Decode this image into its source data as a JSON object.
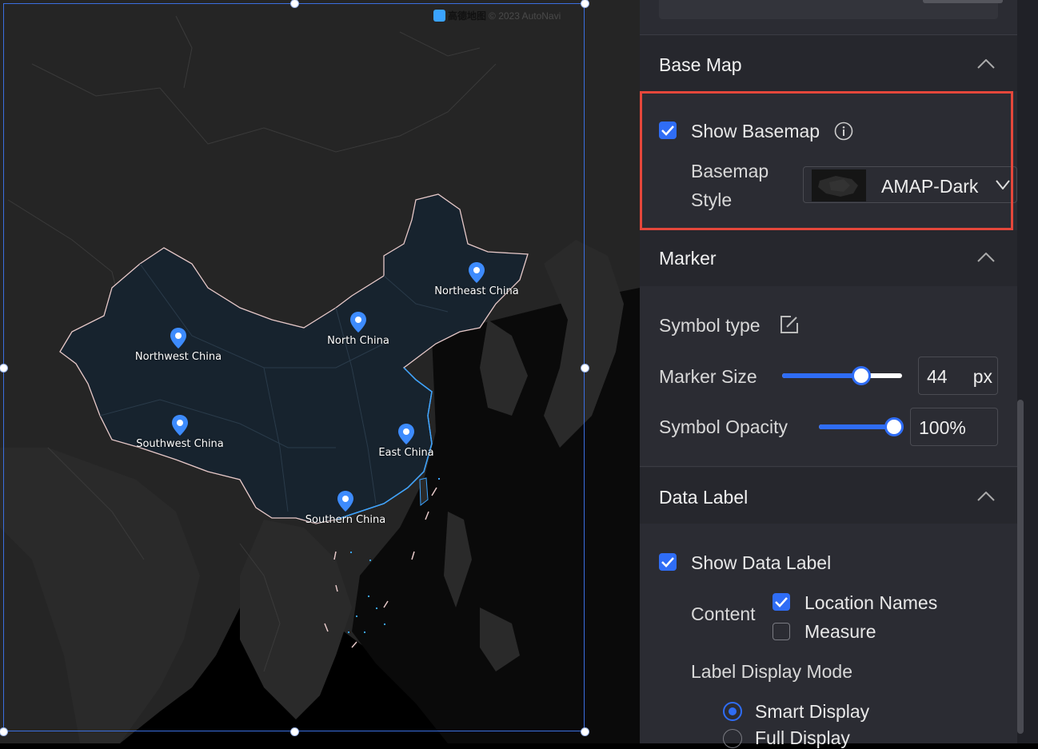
{
  "map": {
    "attribution_brand": "高德地图",
    "attribution_text": "© 2023 AutoNavi",
    "markers": [
      {
        "label": "Northeast China"
      },
      {
        "label": "North China"
      },
      {
        "label": "Northwest China"
      },
      {
        "label": "Southwest China"
      },
      {
        "label": "East China"
      },
      {
        "label": "Southern China"
      }
    ],
    "colors": {
      "region_fill": "#17232e",
      "region_border": "#e7c9c9",
      "marker": "#3d8bfd",
      "coast": "#3aa3ff"
    }
  },
  "panel": {
    "base_map": {
      "title": "Base Map",
      "show_basemap_label": "Show Basemap",
      "show_basemap_checked": true,
      "style_label_line1": "Basemap",
      "style_label_line2": "Style",
      "style_value": "AMAP-Dark"
    },
    "marker": {
      "title": "Marker",
      "symbol_type_label": "Symbol type",
      "marker_size_label": "Marker Size",
      "marker_size_value": "44",
      "marker_size_unit": "px",
      "marker_size_slider_fraction": 0.66,
      "symbol_opacity_label": "Symbol Opacity",
      "symbol_opacity_value": "100%",
      "symbol_opacity_slider_fraction": 1.0
    },
    "data_label": {
      "title": "Data Label",
      "show_data_label_label": "Show Data Label",
      "show_data_label_checked": true,
      "content_label": "Content",
      "location_names_label": "Location Names",
      "location_names_checked": true,
      "measure_label": "Measure",
      "measure_checked": false,
      "display_mode_label": "Label Display Mode",
      "smart_display_label": "Smart Display",
      "smart_display_selected": true,
      "full_display_label": "Full Display"
    },
    "accent_color": "#2f6df6",
    "highlight_color": "#e5473b"
  }
}
